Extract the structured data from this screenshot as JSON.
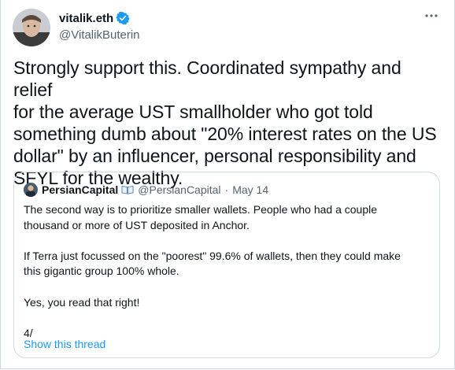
{
  "author": {
    "name": "vitalik.eth",
    "handle": "@VitalikButerin",
    "verified_icon": "verified-badge-icon",
    "more_icon": "more-horizontal-icon"
  },
  "tweet": {
    "text": "Strongly support this. Coordinated sympathy and relief\nfor the average UST smallholder who got told\nsomething dumb about \"20% interest rates on the US\ndollar\" by an influencer, personal responsibility and\nSFYL for the wealthy."
  },
  "quote": {
    "name": "PersianCapital",
    "emoji_icon": "open-book-icon",
    "handle": "@PersianCapital",
    "separator": "·",
    "date": "May 14",
    "body": "The second way is to prioritize smaller wallets. People who had a couple\nthousand or more of UST deposited in Anchor.\n\nIf Terra just focussed on the \"poorest\" 99.6% of wallets, then they could make\nthis gigantic group 100% whole.\n\nYes, you read that right!\n\n4/",
    "show_thread": "Show this thread"
  },
  "colors": {
    "text": "#0f1419",
    "secondary": "#536471",
    "accent": "#1d9bf0",
    "border": "#cfd9de"
  }
}
